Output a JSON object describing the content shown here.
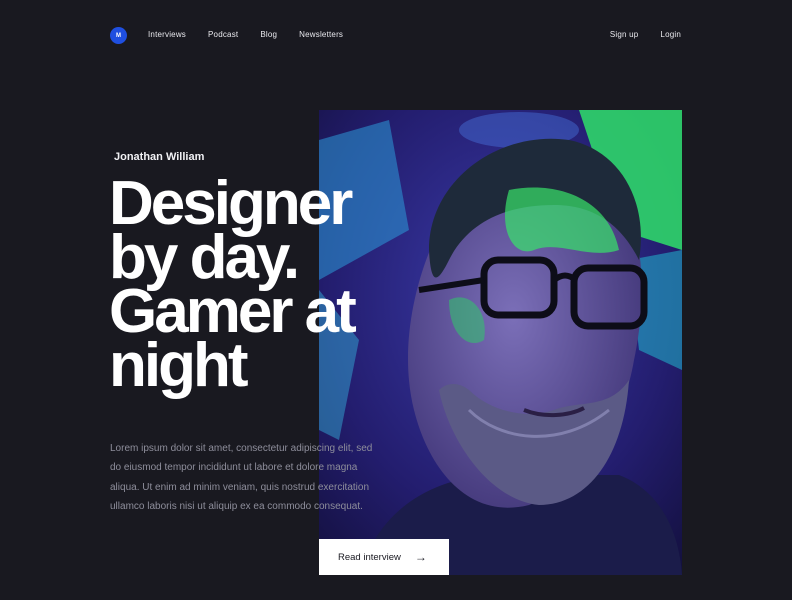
{
  "logo": {
    "text": "M",
    "color": "#1f4fe0"
  },
  "nav": {
    "items": [
      "Interviews",
      "Podcast",
      "Blog",
      "Newsletters"
    ]
  },
  "auth": {
    "signup": "Sign up",
    "login": "Login"
  },
  "hero": {
    "author": "Jonathan William",
    "headline": [
      "Designer",
      "by day.",
      "Gamer at",
      "night"
    ],
    "description": "Lorem ipsum dolor sit amet, consectetur adipiscing elit, sed do eiusmod tempor incididunt ut labore et dolore magna aliqua. Ut enim ad minim veniam, quis nostrud exercitation ullamco laboris nisi ut aliquip ex ea commodo consequat.",
    "cta_label": "Read interview",
    "cta_icon": "arrow-right-icon"
  },
  "colors": {
    "background": "#191920",
    "accent": "#1f4fe0",
    "muted_text": "#8e8e9b"
  }
}
